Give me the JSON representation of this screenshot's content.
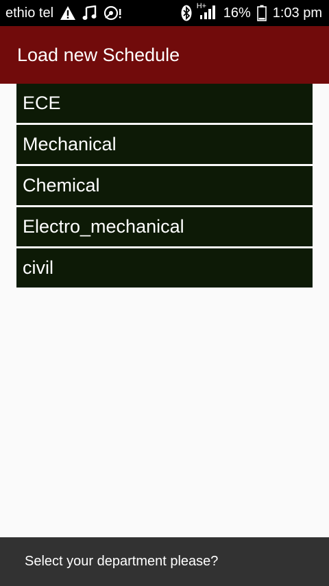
{
  "status_bar": {
    "carrier": "ethio tel",
    "battery": "16%",
    "time": "1:03 pm",
    "network": "H+",
    "icons": [
      "warning-icon",
      "music-note-icon",
      "media-icon",
      "bluetooth-icon",
      "signal-icon",
      "battery-icon"
    ]
  },
  "app_bar": {
    "title": "Load new Schedule",
    "color": "#710b0b"
  },
  "departments": [
    {
      "label": "ECE"
    },
    {
      "label": "Mechanical"
    },
    {
      "label": "Chemical"
    },
    {
      "label": "Electro_mechanical"
    },
    {
      "label": "civil"
    }
  ],
  "toast": {
    "message": "Select your department please?"
  }
}
